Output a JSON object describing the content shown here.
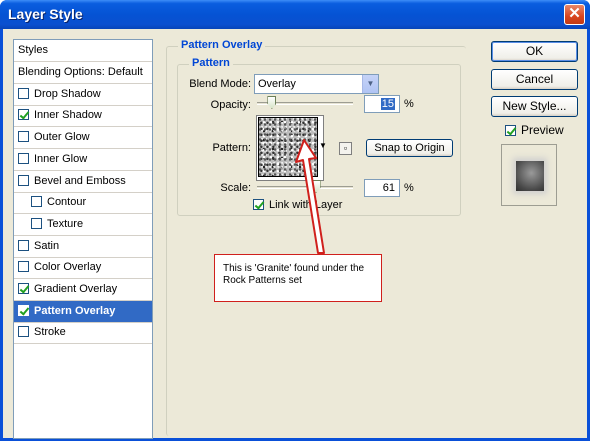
{
  "window": {
    "title": "Layer Style",
    "close_glyph": "✕"
  },
  "styles_panel": {
    "header": "Styles",
    "items": [
      {
        "label": "Blending Options: Default",
        "checkbox": false,
        "checked": false,
        "selected": false,
        "indent": false
      },
      {
        "label": "Drop Shadow",
        "checkbox": true,
        "checked": false,
        "selected": false,
        "indent": false
      },
      {
        "label": "Inner Shadow",
        "checkbox": true,
        "checked": true,
        "selected": false,
        "indent": false
      },
      {
        "label": "Outer Glow",
        "checkbox": true,
        "checked": false,
        "selected": false,
        "indent": false
      },
      {
        "label": "Inner Glow",
        "checkbox": true,
        "checked": false,
        "selected": false,
        "indent": false
      },
      {
        "label": "Bevel and Emboss",
        "checkbox": true,
        "checked": false,
        "selected": false,
        "indent": false
      },
      {
        "label": "Contour",
        "checkbox": true,
        "checked": false,
        "selected": false,
        "indent": true
      },
      {
        "label": "Texture",
        "checkbox": true,
        "checked": false,
        "selected": false,
        "indent": true
      },
      {
        "label": "Satin",
        "checkbox": true,
        "checked": false,
        "selected": false,
        "indent": false
      },
      {
        "label": "Color Overlay",
        "checkbox": true,
        "checked": false,
        "selected": false,
        "indent": false
      },
      {
        "label": "Gradient Overlay",
        "checkbox": true,
        "checked": true,
        "selected": false,
        "indent": false
      },
      {
        "label": "Pattern Overlay",
        "checkbox": true,
        "checked": true,
        "selected": true,
        "indent": false
      },
      {
        "label": "Stroke",
        "checkbox": true,
        "checked": false,
        "selected": false,
        "indent": false
      }
    ]
  },
  "pattern_overlay": {
    "group_title": "Pattern Overlay",
    "subgroup_title": "Pattern",
    "blend_mode_label": "Blend Mode:",
    "blend_mode_value": "Overlay",
    "opacity_label": "Opacity:",
    "opacity_value": "15",
    "opacity_unit": "%",
    "opacity_level": 0.15,
    "pattern_label": "Pattern:",
    "snap_button": "Snap to Origin",
    "scale_label": "Scale:",
    "scale_value": "61",
    "scale_unit": "%",
    "scale_level": 0.61,
    "link_label": "Link with Layer",
    "link_checked": true
  },
  "buttons": {
    "ok": "OK",
    "cancel": "Cancel",
    "new_style": "New Style..."
  },
  "preview": {
    "label": "Preview",
    "checked": true
  },
  "callout": {
    "text": "This is 'Granite' found under the Rock Patterns set",
    "border_color": "#d0201c"
  },
  "colors": {
    "title_bar": "#0553d4",
    "selection": "#316ac5",
    "dialog_bg": "#ece9d8",
    "legend": "#0046d5"
  }
}
